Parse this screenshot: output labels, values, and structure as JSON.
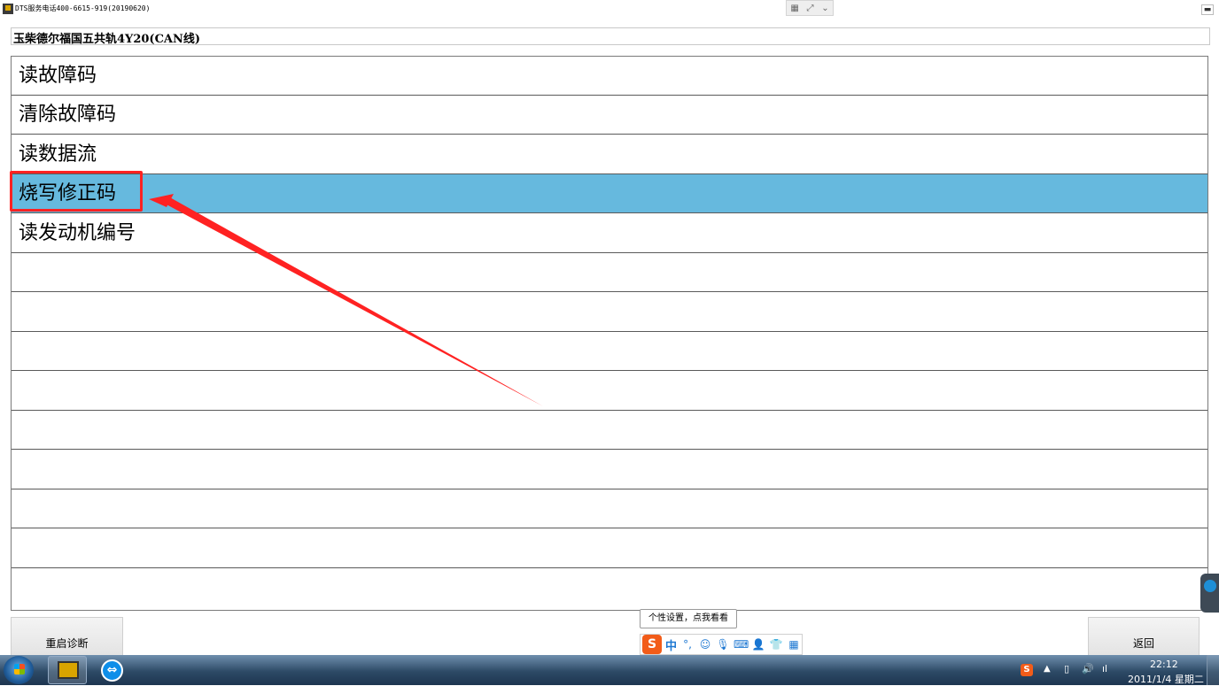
{
  "window": {
    "title": "DTS服务电话400-6615-919(20190620)",
    "minimize_glyph": "▬"
  },
  "toolbar_widget": {
    "icons": [
      "grid-icon",
      "expand-icon",
      "chevron-down-icon"
    ],
    "glyphs": [
      "▦",
      "⤢",
      "⌄"
    ]
  },
  "header": {
    "vehicle": "玉柴德尔福国五共轨4Y20(CAN线)"
  },
  "menu": {
    "items": [
      {
        "label": "读故障码",
        "selected": false
      },
      {
        "label": "清除故障码",
        "selected": false
      },
      {
        "label": "读数据流",
        "selected": false
      },
      {
        "label": "烧写修正码",
        "selected": true
      },
      {
        "label": "读发动机编号",
        "selected": false
      },
      {
        "label": ""
      },
      {
        "label": ""
      },
      {
        "label": ""
      },
      {
        "label": ""
      },
      {
        "label": ""
      },
      {
        "label": ""
      },
      {
        "label": ""
      },
      {
        "label": ""
      },
      {
        "label": ""
      }
    ],
    "selected_color": "#66b9de"
  },
  "annotation": {
    "highlight_color": "#ff2222"
  },
  "buttons": {
    "restart": "重启诊断",
    "back": "返回"
  },
  "ime": {
    "tooltip": "个性设置，点我看看",
    "logo": "S",
    "lang": "中",
    "punct": "°,",
    "icons": [
      "smile-icon",
      "mic-icon",
      "keyboard-icon",
      "user-icon",
      "shirt-icon",
      "apps-icon"
    ],
    "glyphs": [
      "☺",
      "🎙",
      "⌨",
      "👤",
      "👕",
      "▦"
    ]
  },
  "taskbar": {
    "apps": [
      "diagnostic-app-icon",
      "teamviewer-icon"
    ],
    "teamviewer_glyph": "⇔",
    "tray_logo": "S",
    "time": "22:12",
    "date": "2011/1/4 星期二"
  }
}
